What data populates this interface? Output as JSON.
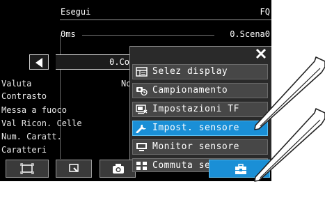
{
  "header": {
    "mode": "Esegui",
    "model": "FQ",
    "time": "0ms",
    "scene": "0.Scena0"
  },
  "scene_selector": {
    "value": "0.Co"
  },
  "params": [
    "Valuta",
    "Contrasto",
    "Messa a fuoco",
    "Val Ricon. Celle",
    "Num. Caratt.",
    "Caratteri"
  ],
  "partial_value": "No",
  "menu": {
    "items": [
      {
        "label": "Selez display",
        "icon": "display-icon"
      },
      {
        "label": "Campionamento",
        "icon": "sampling-icon"
      },
      {
        "label": "Impostazioni TF",
        "icon": "tf-settings-icon"
      },
      {
        "label": "Impost. sensore",
        "icon": "wrench-icon",
        "selected": true
      },
      {
        "label": "Monitor sensore",
        "icon": "monitor-icon"
      },
      {
        "label": "Commuta sensore",
        "icon": "switch-sensor-icon"
      }
    ]
  },
  "colors": {
    "accent": "#1a8fd6",
    "background": "#000000",
    "menu_item": "#474747"
  }
}
